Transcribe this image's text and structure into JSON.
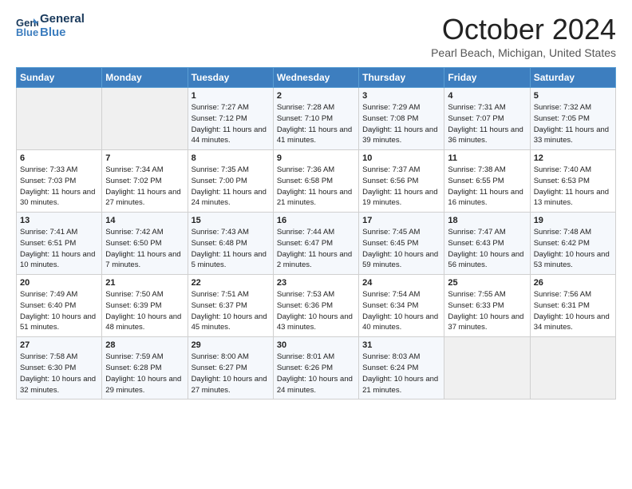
{
  "header": {
    "logo_line1": "General",
    "logo_line2": "Blue",
    "month": "October 2024",
    "location": "Pearl Beach, Michigan, United States"
  },
  "weekdays": [
    "Sunday",
    "Monday",
    "Tuesday",
    "Wednesday",
    "Thursday",
    "Friday",
    "Saturday"
  ],
  "weeks": [
    [
      {
        "day": "",
        "sunrise": "",
        "sunset": "",
        "daylight": ""
      },
      {
        "day": "",
        "sunrise": "",
        "sunset": "",
        "daylight": ""
      },
      {
        "day": "1",
        "sunrise": "Sunrise: 7:27 AM",
        "sunset": "Sunset: 7:12 PM",
        "daylight": "Daylight: 11 hours and 44 minutes."
      },
      {
        "day": "2",
        "sunrise": "Sunrise: 7:28 AM",
        "sunset": "Sunset: 7:10 PM",
        "daylight": "Daylight: 11 hours and 41 minutes."
      },
      {
        "day": "3",
        "sunrise": "Sunrise: 7:29 AM",
        "sunset": "Sunset: 7:08 PM",
        "daylight": "Daylight: 11 hours and 39 minutes."
      },
      {
        "day": "4",
        "sunrise": "Sunrise: 7:31 AM",
        "sunset": "Sunset: 7:07 PM",
        "daylight": "Daylight: 11 hours and 36 minutes."
      },
      {
        "day": "5",
        "sunrise": "Sunrise: 7:32 AM",
        "sunset": "Sunset: 7:05 PM",
        "daylight": "Daylight: 11 hours and 33 minutes."
      }
    ],
    [
      {
        "day": "6",
        "sunrise": "Sunrise: 7:33 AM",
        "sunset": "Sunset: 7:03 PM",
        "daylight": "Daylight: 11 hours and 30 minutes."
      },
      {
        "day": "7",
        "sunrise": "Sunrise: 7:34 AM",
        "sunset": "Sunset: 7:02 PM",
        "daylight": "Daylight: 11 hours and 27 minutes."
      },
      {
        "day": "8",
        "sunrise": "Sunrise: 7:35 AM",
        "sunset": "Sunset: 7:00 PM",
        "daylight": "Daylight: 11 hours and 24 minutes."
      },
      {
        "day": "9",
        "sunrise": "Sunrise: 7:36 AM",
        "sunset": "Sunset: 6:58 PM",
        "daylight": "Daylight: 11 hours and 21 minutes."
      },
      {
        "day": "10",
        "sunrise": "Sunrise: 7:37 AM",
        "sunset": "Sunset: 6:56 PM",
        "daylight": "Daylight: 11 hours and 19 minutes."
      },
      {
        "day": "11",
        "sunrise": "Sunrise: 7:38 AM",
        "sunset": "Sunset: 6:55 PM",
        "daylight": "Daylight: 11 hours and 16 minutes."
      },
      {
        "day": "12",
        "sunrise": "Sunrise: 7:40 AM",
        "sunset": "Sunset: 6:53 PM",
        "daylight": "Daylight: 11 hours and 13 minutes."
      }
    ],
    [
      {
        "day": "13",
        "sunrise": "Sunrise: 7:41 AM",
        "sunset": "Sunset: 6:51 PM",
        "daylight": "Daylight: 11 hours and 10 minutes."
      },
      {
        "day": "14",
        "sunrise": "Sunrise: 7:42 AM",
        "sunset": "Sunset: 6:50 PM",
        "daylight": "Daylight: 11 hours and 7 minutes."
      },
      {
        "day": "15",
        "sunrise": "Sunrise: 7:43 AM",
        "sunset": "Sunset: 6:48 PM",
        "daylight": "Daylight: 11 hours and 5 minutes."
      },
      {
        "day": "16",
        "sunrise": "Sunrise: 7:44 AM",
        "sunset": "Sunset: 6:47 PM",
        "daylight": "Daylight: 11 hours and 2 minutes."
      },
      {
        "day": "17",
        "sunrise": "Sunrise: 7:45 AM",
        "sunset": "Sunset: 6:45 PM",
        "daylight": "Daylight: 10 hours and 59 minutes."
      },
      {
        "day": "18",
        "sunrise": "Sunrise: 7:47 AM",
        "sunset": "Sunset: 6:43 PM",
        "daylight": "Daylight: 10 hours and 56 minutes."
      },
      {
        "day": "19",
        "sunrise": "Sunrise: 7:48 AM",
        "sunset": "Sunset: 6:42 PM",
        "daylight": "Daylight: 10 hours and 53 minutes."
      }
    ],
    [
      {
        "day": "20",
        "sunrise": "Sunrise: 7:49 AM",
        "sunset": "Sunset: 6:40 PM",
        "daylight": "Daylight: 10 hours and 51 minutes."
      },
      {
        "day": "21",
        "sunrise": "Sunrise: 7:50 AM",
        "sunset": "Sunset: 6:39 PM",
        "daylight": "Daylight: 10 hours and 48 minutes."
      },
      {
        "day": "22",
        "sunrise": "Sunrise: 7:51 AM",
        "sunset": "Sunset: 6:37 PM",
        "daylight": "Daylight: 10 hours and 45 minutes."
      },
      {
        "day": "23",
        "sunrise": "Sunrise: 7:53 AM",
        "sunset": "Sunset: 6:36 PM",
        "daylight": "Daylight: 10 hours and 43 minutes."
      },
      {
        "day": "24",
        "sunrise": "Sunrise: 7:54 AM",
        "sunset": "Sunset: 6:34 PM",
        "daylight": "Daylight: 10 hours and 40 minutes."
      },
      {
        "day": "25",
        "sunrise": "Sunrise: 7:55 AM",
        "sunset": "Sunset: 6:33 PM",
        "daylight": "Daylight: 10 hours and 37 minutes."
      },
      {
        "day": "26",
        "sunrise": "Sunrise: 7:56 AM",
        "sunset": "Sunset: 6:31 PM",
        "daylight": "Daylight: 10 hours and 34 minutes."
      }
    ],
    [
      {
        "day": "27",
        "sunrise": "Sunrise: 7:58 AM",
        "sunset": "Sunset: 6:30 PM",
        "daylight": "Daylight: 10 hours and 32 minutes."
      },
      {
        "day": "28",
        "sunrise": "Sunrise: 7:59 AM",
        "sunset": "Sunset: 6:28 PM",
        "daylight": "Daylight: 10 hours and 29 minutes."
      },
      {
        "day": "29",
        "sunrise": "Sunrise: 8:00 AM",
        "sunset": "Sunset: 6:27 PM",
        "daylight": "Daylight: 10 hours and 27 minutes."
      },
      {
        "day": "30",
        "sunrise": "Sunrise: 8:01 AM",
        "sunset": "Sunset: 6:26 PM",
        "daylight": "Daylight: 10 hours and 24 minutes."
      },
      {
        "day": "31",
        "sunrise": "Sunrise: 8:03 AM",
        "sunset": "Sunset: 6:24 PM",
        "daylight": "Daylight: 10 hours and 21 minutes."
      },
      {
        "day": "",
        "sunrise": "",
        "sunset": "",
        "daylight": ""
      },
      {
        "day": "",
        "sunrise": "",
        "sunset": "",
        "daylight": ""
      }
    ]
  ]
}
